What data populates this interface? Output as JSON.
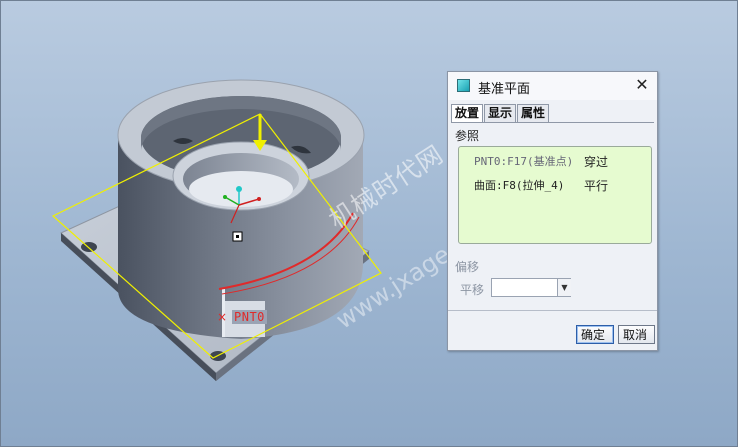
{
  "model": {
    "point_label": "PNT0",
    "watermark_cn": "机械时代网",
    "watermark_url": "www.jxage.com"
  },
  "dialog": {
    "title": "基准平面",
    "close_glyph": "✕",
    "tabs": [
      {
        "label": "放置",
        "active": true
      },
      {
        "label": "显示",
        "active": false
      },
      {
        "label": "属性",
        "active": false
      }
    ],
    "references_label": "参照",
    "references": [
      {
        "item": "PNT0:F17(基准点)",
        "constraint": "穿过"
      },
      {
        "item": "曲面:F8(拉伸_4)",
        "constraint": "平行"
      }
    ],
    "offset_label": "偏移",
    "translate_label": "平移",
    "translate_value": "",
    "ok_label": "确定",
    "cancel_label": "取消"
  },
  "colors": {
    "background_top": "#b9cbe0",
    "plane_outline": "#f0f000",
    "reference_box": "#e6fbd0",
    "highlight_edge": "#e02a2a"
  }
}
